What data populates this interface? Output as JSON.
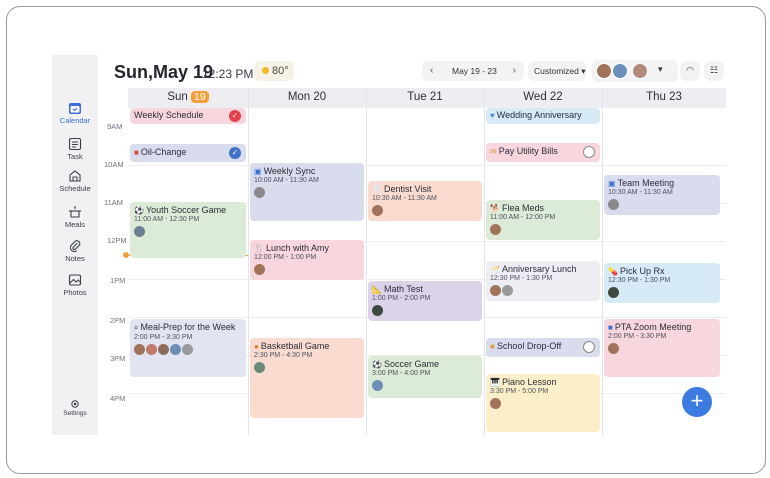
{
  "header": {
    "date": "Sun,May 19",
    "time": "12:23 PM",
    "weather": "80°",
    "prev_icon": "‹",
    "next_icon": "›",
    "range": "May 19 - 23",
    "view": "Customized ▾",
    "more": "▾",
    "wifi": "◠",
    "settings_sliders": "☷"
  },
  "sidebar": {
    "items": [
      {
        "label": "Calendar"
      },
      {
        "label": "Task"
      },
      {
        "label": "Schedule"
      },
      {
        "label": "Meals"
      },
      {
        "label": "Notes"
      },
      {
        "label": "Photos"
      },
      {
        "label": "Settings"
      }
    ]
  },
  "days": [
    {
      "label": "Sun",
      "num": "19"
    },
    {
      "label": "Mon 20"
    },
    {
      "label": "Tue 21"
    },
    {
      "label": "Wed 22"
    },
    {
      "label": "Thu 23"
    }
  ],
  "hours": [
    "9AM",
    "10AM",
    "11AM",
    "12PM",
    "1PM",
    "2PM",
    "3PM",
    "4PM"
  ],
  "events": {
    "weekly_schedule": {
      "title": "Weekly Schedule"
    },
    "oil_change": {
      "title": "Oil-Change"
    },
    "youth_soccer": {
      "title": "Youth Soccer Game",
      "time": "11:00 AM - 12:30 PM"
    },
    "meal_prep": {
      "title": "Meal-Prep for the Week",
      "time": "2:00 PM - 3:30 PM"
    },
    "weekly_sync": {
      "title": "Weekly Sync",
      "time": "10:00 AM - 11:30 AM"
    },
    "lunch_amy": {
      "title": "Lunch with Amy",
      "time": "12:00 PM - 1:00 PM"
    },
    "basketball": {
      "title": "Basketball Game",
      "time": "2:30 PM - 4:30 PM"
    },
    "dentist": {
      "title": "Dentist Visit",
      "time": "10:30 AM - 11:30 AM"
    },
    "math_test": {
      "title": "Math Test",
      "time": "1:00 PM - 2:00 PM"
    },
    "soccer_game": {
      "title": "Soccer Game",
      "time": "3:00 PM - 4:00 PM"
    },
    "wedding": {
      "title": "Wedding Anniversary"
    },
    "utility_bills": {
      "title": "Pay Utility Bills"
    },
    "flea_meds": {
      "title": "Flea Meds",
      "time": "11:00 AM - 12:00 PM"
    },
    "anniv_lunch": {
      "title": "Anniversary Lunch",
      "time": "12:30 PM - 1:30 PM"
    },
    "school_dropoff": {
      "title": "School Drop-Off"
    },
    "piano": {
      "title": "Piano Lesson",
      "time": "3:30 PM - 5:00 PM"
    },
    "team_meeting": {
      "title": "Team Meeting",
      "time": "10:30 AM - 11:30 AM"
    },
    "pick_up_rx": {
      "title": "Pick Up Rx",
      "time": "12:30 PM - 1:30 PM"
    },
    "pta_zoom": {
      "title": "PTA Zoom Meeting",
      "time": "2:00 PM - 3:30 PM"
    }
  },
  "fab": "+",
  "colors": {
    "accent": "#3c7be0",
    "today": "#f3a03a",
    "check_red": "#e8414b",
    "check_blue": "#3f73c9"
  }
}
